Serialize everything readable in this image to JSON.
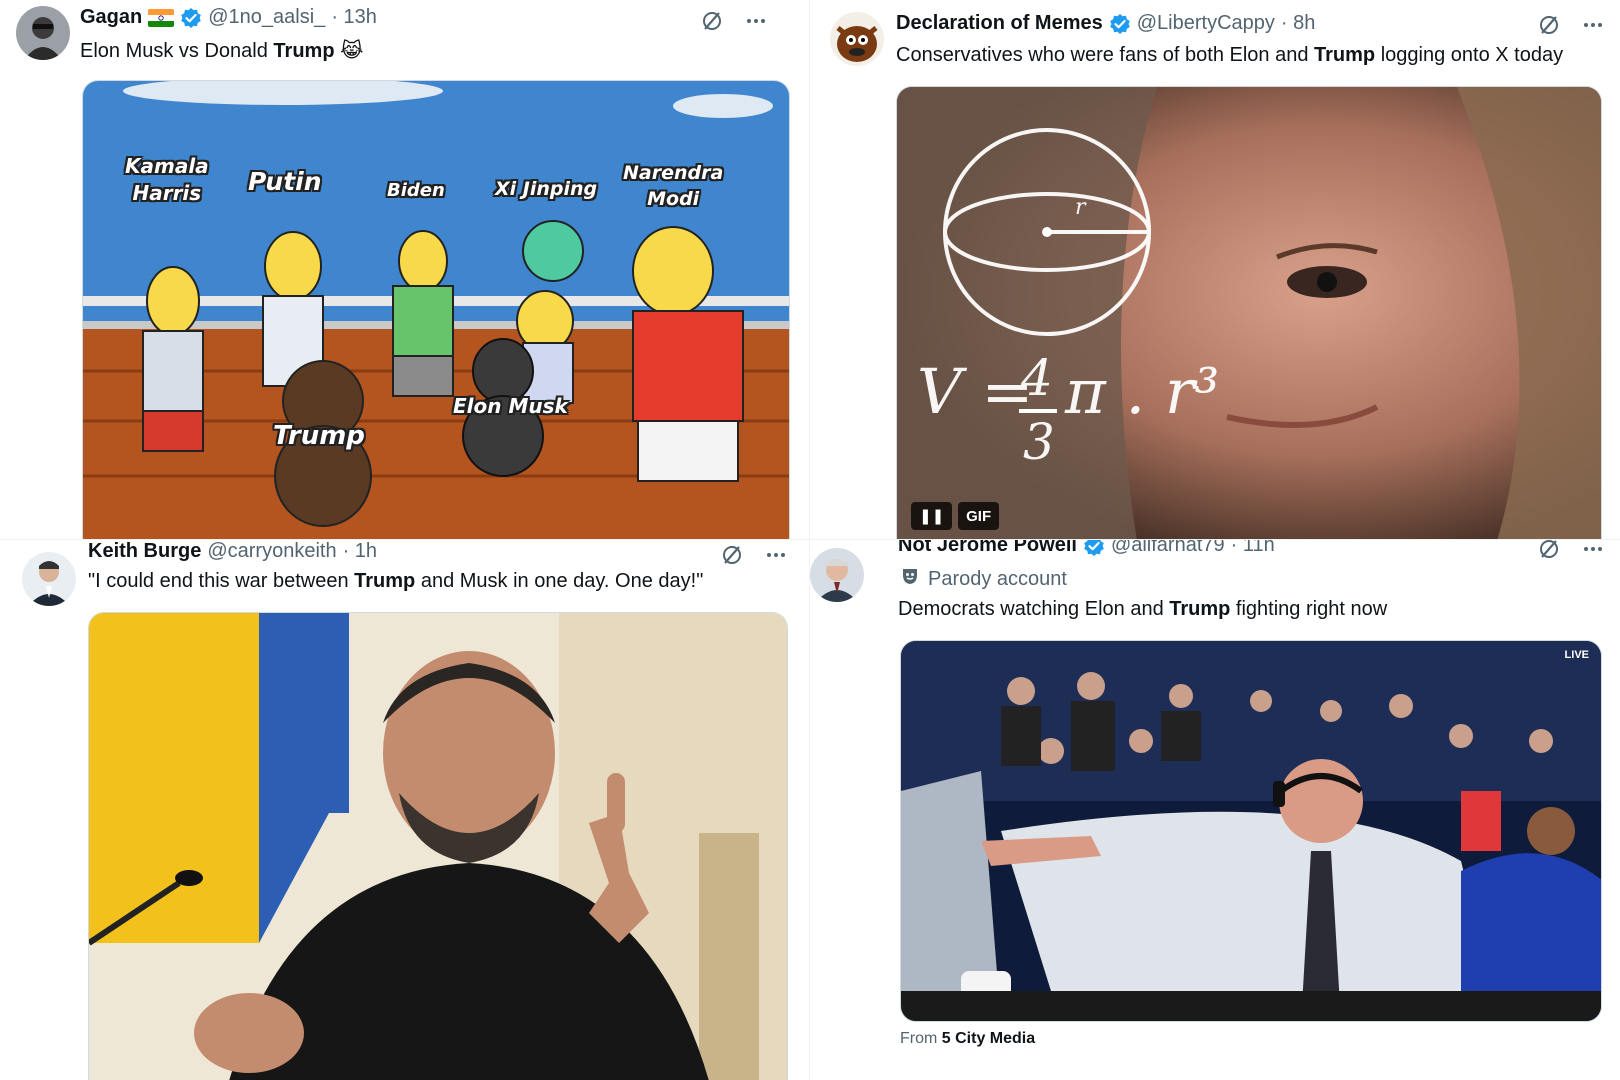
{
  "colors": {
    "verified": "#1d9bf0",
    "text": "#0f1419",
    "muted": "#536471",
    "border": "#cfd9de"
  },
  "tweets": [
    {
      "name": "Gagan",
      "handle": "@1no_aalsi_",
      "time": "· 13h",
      "text_parts": [
        "Elon Musk vs Donald ",
        "Trump",
        " 😹"
      ],
      "meme_labels": [
        "Kamala\nHarris",
        "Putin",
        "Biden",
        "Xi Jinping",
        "Narendra\nModi",
        "Elon Musk",
        "Trump"
      ]
    },
    {
      "name": "Declaration of Memes",
      "handle": "@LibertyCappy",
      "time": "· 8h",
      "text_parts": [
        "Conservatives who were fans of both Elon and ",
        "Trump",
        " logging onto X today"
      ],
      "gif_pause": "❚❚",
      "gif_label": "GIF",
      "formula_lhs": "V = ",
      "formula_num": "4",
      "formula_den": "3",
      "formula_rhs": "π . r³",
      "formula_r": "r"
    },
    {
      "name": "Keith Burge",
      "handle": "@carryonkeith",
      "time": "· 1h",
      "text_parts": [
        "\"I could end this war between ",
        "Trump",
        " and Musk in one day. One day!\""
      ]
    },
    {
      "name": "Not Jerome Powell",
      "handle": "@alifarhat79",
      "time": "· 11h",
      "parody": "Parody account",
      "text_parts": [
        "Democrats watching Elon and ",
        "Trump",
        " fighting right now"
      ],
      "live_badge": "LIVE",
      "from_prefix": "From ",
      "from_source": "5 City Media"
    }
  ],
  "icons": {
    "grok": "grok-icon",
    "more": "more-icon",
    "verified": "verified-badge-icon",
    "flag": "india-flag-icon",
    "parody": "parody-mask-icon"
  }
}
